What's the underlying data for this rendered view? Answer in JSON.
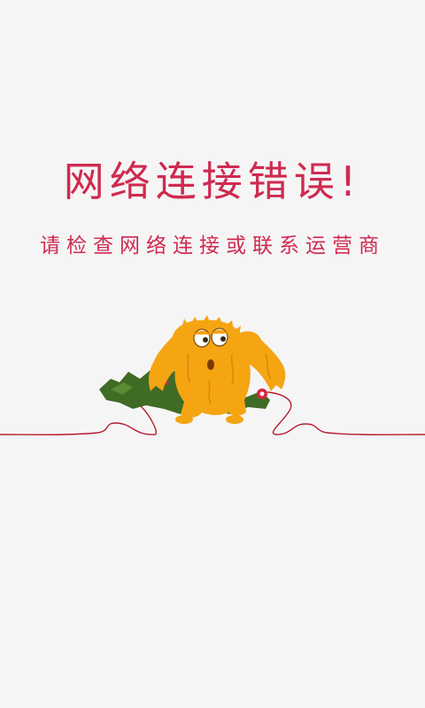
{
  "error": {
    "title": "网络连接错误!",
    "subtitle": "请检查网络连接或联系运营商"
  },
  "illustration": {
    "icon": "disconnected-cable-monster-icon"
  },
  "colors": {
    "background": "#f5f5f5",
    "accent": "#cf2a50",
    "cable": "#b51c2e",
    "monster": "#f5a412",
    "grass": "#3f6b24"
  }
}
